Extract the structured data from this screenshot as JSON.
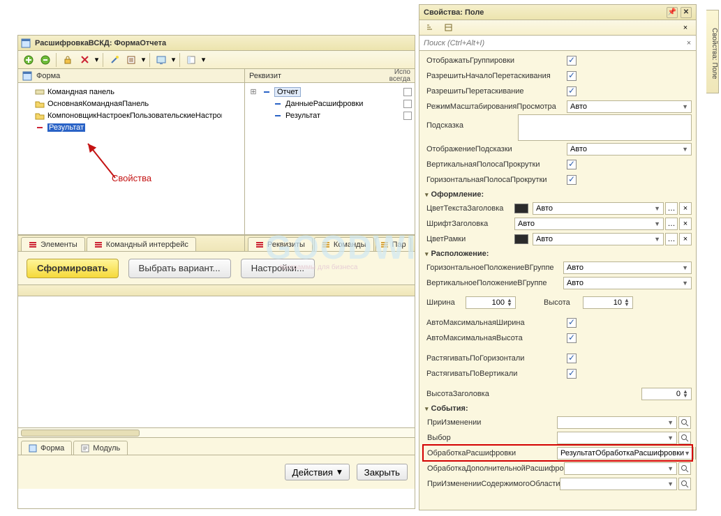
{
  "doc": {
    "title": "РасшифровкаВСКД: ФормаОтчета",
    "toolbar_icons": [
      "add-icon",
      "delete-icon",
      "separator",
      "lock-icon",
      "save-icon",
      "dropdown",
      "separator",
      "wand-icon",
      "trash-icon",
      "dropdown",
      "separator",
      "screen-icon",
      "dropdown",
      "separator",
      "form-icon",
      "dropdown"
    ]
  },
  "left_tree": {
    "header": "Форма",
    "items": [
      {
        "icon": "bar",
        "label": "Командная панель",
        "indent": 1
      },
      {
        "icon": "folder",
        "label": "ОсновнаяКоманднаяПанель",
        "indent": 1
      },
      {
        "icon": "folder",
        "label": "КомпоновщикНастроекПользовательскиеНастройки",
        "indent": 1,
        "cut": true
      },
      {
        "icon": "item-red",
        "label": "Результат",
        "indent": 1,
        "selected": true
      }
    ]
  },
  "right_tree": {
    "header": "Реквизит",
    "col2": "Использовать всегда",
    "items": [
      {
        "icon": "folder",
        "label": "Отчет",
        "indent": 0,
        "expand": "+"
      },
      {
        "icon": "item",
        "label": "ДанныеРасшифровки",
        "indent": 1
      },
      {
        "icon": "item",
        "label": "Результат",
        "indent": 1
      }
    ]
  },
  "left_tabs": [
    {
      "icon": "red",
      "label": "Элементы"
    },
    {
      "icon": "red",
      "label": "Командный интерфейс"
    }
  ],
  "right_tabs": [
    {
      "icon": "red",
      "label": "Реквизиты"
    },
    {
      "icon": "gold",
      "label": "Команды"
    },
    {
      "icon": "gold",
      "label": "Параметры",
      "cut": true,
      "labelShort": "Пар"
    }
  ],
  "buttons": {
    "form": "Сформировать",
    "variant": "Выбрать вариант...",
    "settings": "Настройки..."
  },
  "bottom_tabs": [
    {
      "icon": "form",
      "label": "Форма"
    },
    {
      "icon": "module",
      "label": "Модуль"
    }
  ],
  "bottom_bar": {
    "actions": "Действия",
    "close": "Закрыть",
    "dd": "▾"
  },
  "annotation": "Свойства",
  "watermark": "GOODWILL",
  "watermark_sub": "программы для бизнеса",
  "flap": "Свойства: Поле",
  "props": {
    "title": "Свойства: Поле",
    "search_ph": "Поиск (Ctrl+Alt+I)",
    "rows_top": [
      {
        "label": "ОтображатьГруппировки",
        "type": "check",
        "on": true
      },
      {
        "label": "РазрешитьНачалоПеретаскивания",
        "type": "check",
        "on": true
      },
      {
        "label": "РазрешитьПеретаскивание",
        "type": "check",
        "on": true
      },
      {
        "label": "РежимМасштабированияПросмотра",
        "type": "select",
        "value": "Авто"
      },
      {
        "label": "Подсказка",
        "type": "textarea"
      },
      {
        "label": "ОтображениеПодсказки",
        "type": "select",
        "value": "Авто"
      },
      {
        "label": "ВертикальнаяПолосаПрокрутки",
        "type": "check",
        "on": true
      },
      {
        "label": "ГоризонтальнаяПолосаПрокрутки",
        "type": "check",
        "on": true
      }
    ],
    "sect_style": "Оформление:",
    "rows_style": [
      {
        "label": "ЦветТекстаЗаголовка",
        "type": "color",
        "value": "Авто",
        "swatch": "#2b2b2b"
      },
      {
        "label": "ШрифтЗаголовка",
        "type": "select",
        "value": "Авто",
        "ell": true,
        "x": true
      },
      {
        "label": "ЦветРамки",
        "type": "color",
        "value": "Авто",
        "swatch": "#2b2b2b"
      }
    ],
    "sect_layout": "Расположение:",
    "rows_layout1": [
      {
        "label": "ГоризонтальноеПоложениеВГруппе",
        "type": "select",
        "value": "Авто"
      },
      {
        "label": "ВертикальноеПоложениеВГруппе",
        "type": "select",
        "value": "Авто"
      }
    ],
    "width_label": "Ширина",
    "width_value": "100",
    "height_label": "Высота",
    "height_value": "10",
    "rows_layout2": [
      {
        "label": "АвтоМаксимальнаяШирина",
        "type": "check",
        "on": true
      },
      {
        "label": "АвтоМаксимальнаяВысота",
        "type": "check",
        "on": true
      }
    ],
    "rows_layout3": [
      {
        "label": "РастягиватьПоГоризонтали",
        "type": "check",
        "on": true
      },
      {
        "label": "РастягиватьПоВертикали",
        "type": "check",
        "on": true
      }
    ],
    "header_h_label": "ВысотаЗаголовка",
    "header_h_value": "0",
    "sect_events": "События:",
    "events": [
      {
        "label": "ПриИзменении",
        "value": ""
      },
      {
        "label": "Выбор",
        "value": ""
      },
      {
        "label": "ОбработкаРасшифровки",
        "value": "РезультатОбработкаРасшифровки",
        "hl": true
      },
      {
        "label": "ОбработкаДополнительнойРасшифровки",
        "value": "",
        "cut": true,
        "labelShort": "ОбработкаДополнительнойРасшифро"
      },
      {
        "label": "ПриИзмененииСодержимогоОбласти",
        "value": ""
      }
    ]
  }
}
